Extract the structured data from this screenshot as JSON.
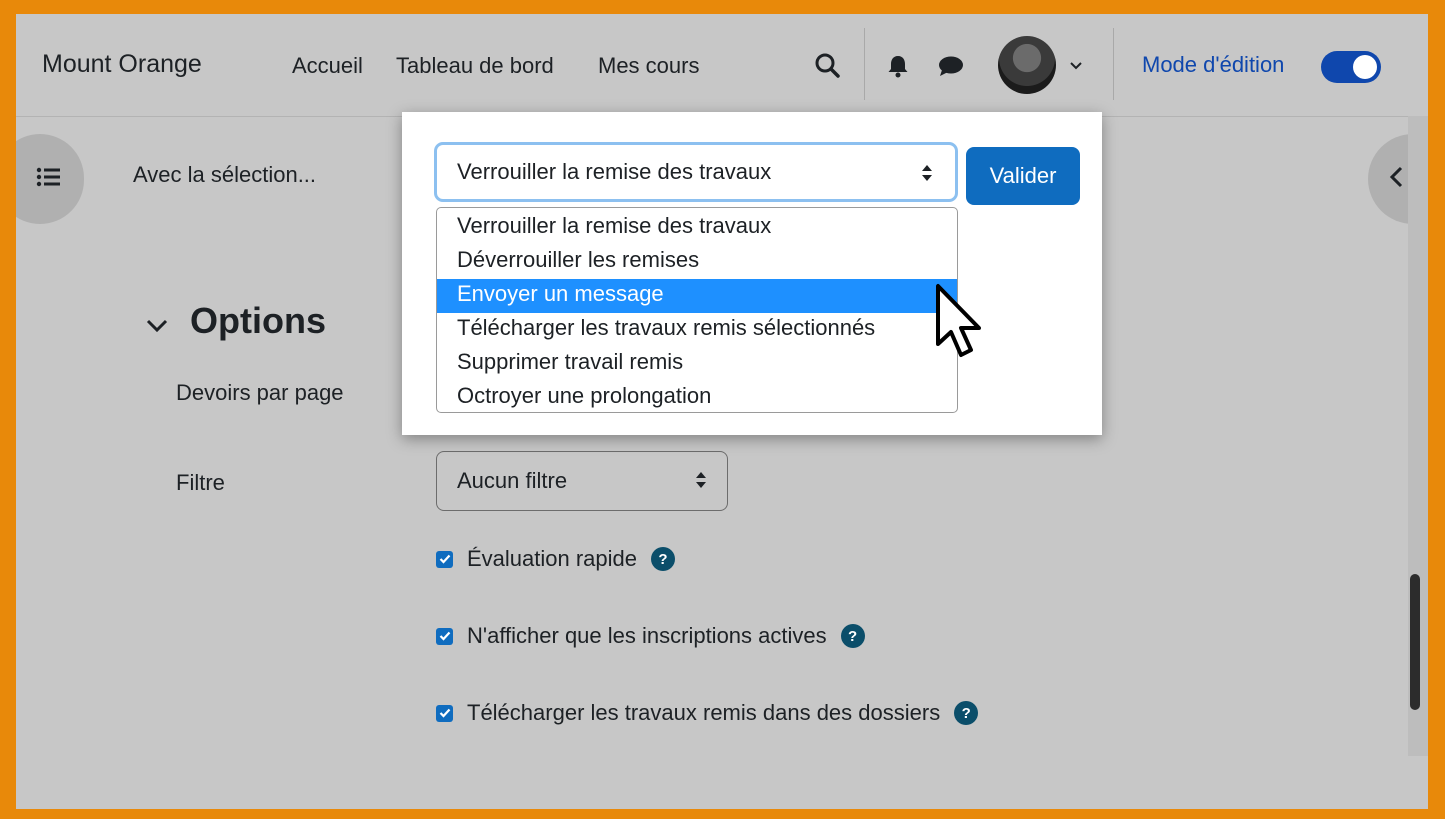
{
  "header": {
    "brand": "Mount Orange",
    "nav": [
      "Accueil",
      "Tableau de bord",
      "Mes cours"
    ],
    "edit_mode_label": "Mode d'édition",
    "edit_mode_on": true
  },
  "bulk_action": {
    "label": "Avec la sélection...",
    "selected": "Verrouiller la remise des travaux",
    "submit_label": "Valider",
    "options": [
      "Verrouiller la remise des travaux",
      "Déverrouiller les remises",
      "Envoyer un message",
      "Télécharger les travaux remis sélectionnés",
      "Supprimer travail remis",
      "Octroyer une prolongation"
    ],
    "highlighted_index": 2
  },
  "options": {
    "title": "Options",
    "per_page_label": "Devoirs par page",
    "filter_label": "Filtre",
    "filter_value": "Aucun filtre",
    "checks": [
      {
        "label": "Évaluation rapide",
        "checked": true
      },
      {
        "label": "N'afficher que les inscriptions actives",
        "checked": true
      },
      {
        "label": "Télécharger les travaux remis dans des dossiers",
        "checked": true
      }
    ]
  },
  "colors": {
    "frame": "#e8890a",
    "primary": "#0f6cbf",
    "highlight": "#1e90ff",
    "help": "#0b4e6a"
  }
}
